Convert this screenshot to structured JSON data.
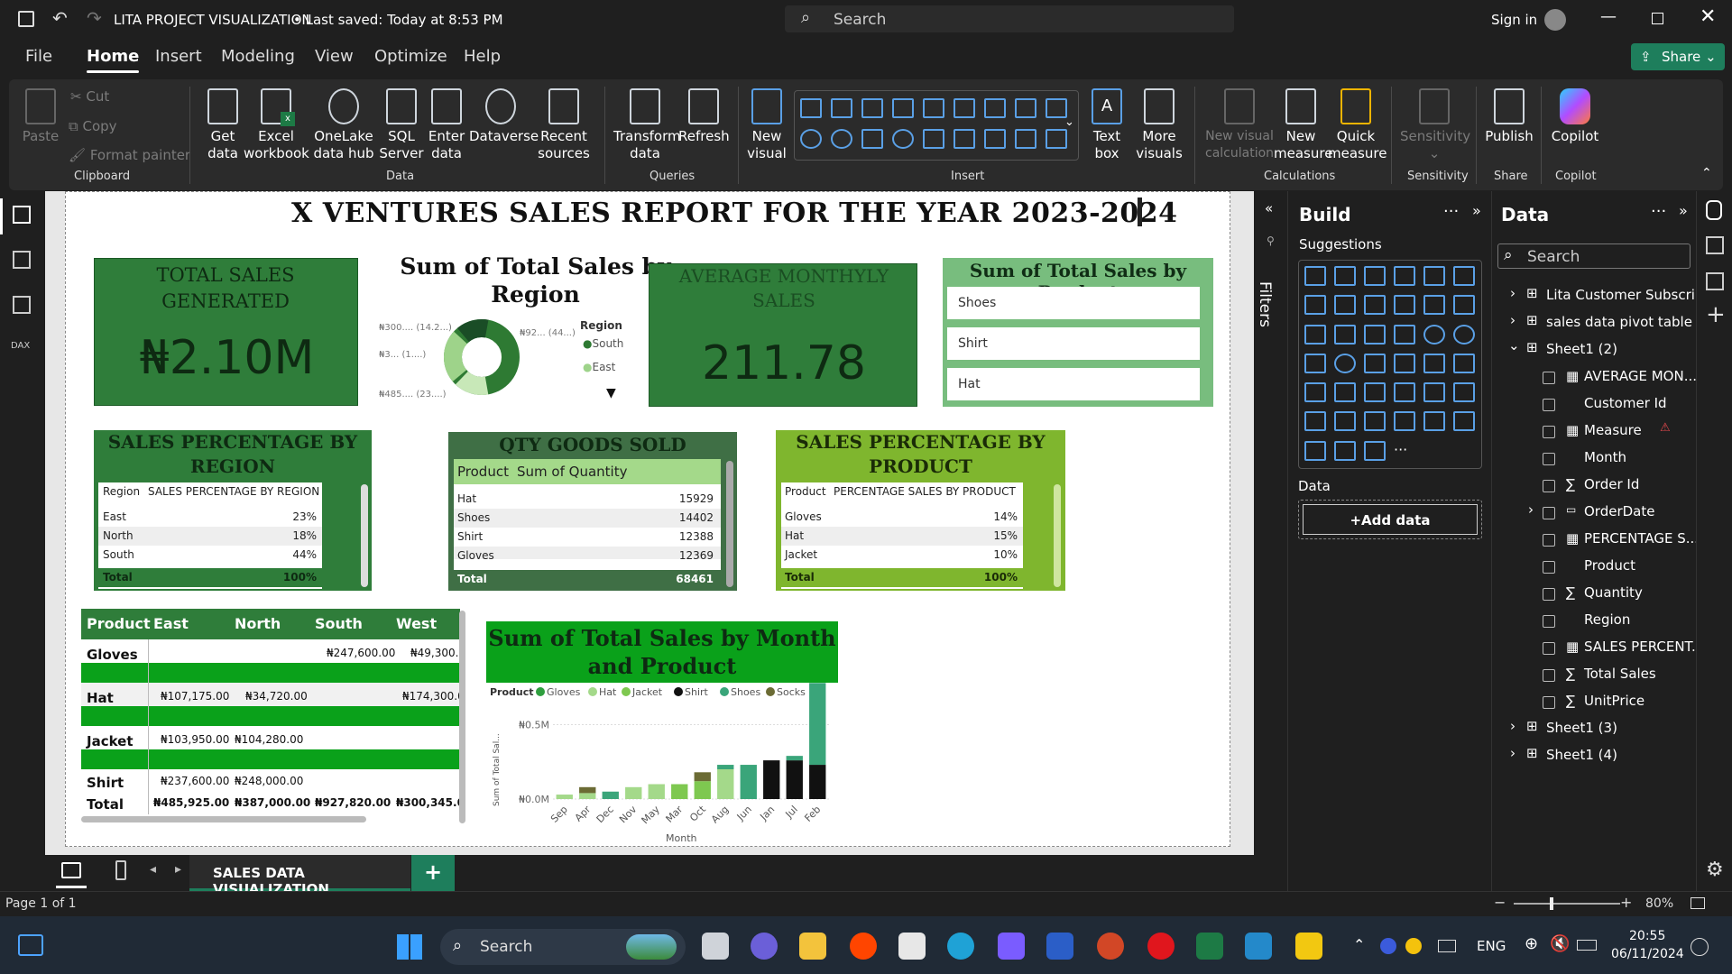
{
  "titlebar": {
    "title": "LITA PROJECT VISUALIZATION",
    "saved": "• Last saved: Today at 8:53 PM",
    "search_placeholder": "Search",
    "signin": "Sign in"
  },
  "menu": [
    "File",
    "Home",
    "Insert",
    "Modeling",
    "View",
    "Optimize",
    "Help"
  ],
  "share_label": "Share",
  "ribbon": {
    "clipboard": {
      "paste": "Paste",
      "cut": "Cut",
      "copy": "Copy",
      "format_painter": "Format painter",
      "group": "Clipboard"
    },
    "data": {
      "get_data": "Get\ndata",
      "excel": "Excel\nworkbook",
      "onelake": "OneLake\ndata hub",
      "sql": "SQL\nServer",
      "enter": "Enter\ndata",
      "dataverse": "Dataverse",
      "recent": "Recent\nsources",
      "group": "Data"
    },
    "queries": {
      "transform": "Transform\ndata",
      "refresh": "Refresh",
      "group": "Queries"
    },
    "insert": {
      "new_visual": "New\nvisual",
      "text_box": "Text\nbox",
      "more_visuals": "More\nvisuals",
      "group": "Insert"
    },
    "calculations": {
      "new_visual_calc": "New visual\ncalculation",
      "new_measure": "New\nmeasure",
      "quick_measure": "Quick\nmeasure",
      "group": "Calculations"
    },
    "sensitivity": {
      "label": "Sensitivity",
      "group": "Sensitivity"
    },
    "share": {
      "publish": "Publish",
      "group": "Share"
    },
    "copilot": {
      "label": "Copilot",
      "group": "Copilot"
    }
  },
  "report": {
    "title": "X VENTURES SALES REPORT FOR THE YEAR 2023-2024",
    "total_sales": {
      "label": "TOTAL SALES GENERATED",
      "value": "₦2.10M"
    },
    "region_donut": {
      "title": "Sum of Total Sales by Region",
      "legend_title": "Region",
      "legend": [
        "South",
        "East"
      ],
      "labels": [
        "₦300.... (14.2...)",
        "₦3... (1....)",
        "₦485.... (23....)",
        "₦92... (44...)"
      ]
    },
    "avg_monthly": {
      "label": "AVERAGE MONTHYLY SALES",
      "value": "211.78"
    },
    "product_slicer": {
      "title": "Sum of Total Sales by Product",
      "items": [
        "Shoes",
        "Shirt",
        "Hat"
      ]
    },
    "pct_region": {
      "title": "SALES PERCENTAGE BY REGION",
      "headers": [
        "Region",
        "SALES PERCENTAGE BY REGION"
      ],
      "rows": [
        [
          "East",
          "23%"
        ],
        [
          "North",
          "18%"
        ],
        [
          "South",
          "44%"
        ]
      ],
      "total": [
        "Total",
        "100%"
      ]
    },
    "qty_goods": {
      "title": "QTY GOODS SOLD",
      "headers": [
        "Product",
        "Sum of Quantity"
      ],
      "rows": [
        [
          "Hat",
          "15929"
        ],
        [
          "Shoes",
          "14402"
        ],
        [
          "Shirt",
          "12388"
        ],
        [
          "Gloves",
          "12369"
        ]
      ],
      "total": [
        "Total",
        "68461"
      ]
    },
    "pct_product": {
      "title": "SALES PERCENTAGE BY PRODUCT",
      "headers": [
        "Product",
        "PERCENTAGE SALES BY PRODUCT"
      ],
      "rows": [
        [
          "Gloves",
          "14%"
        ],
        [
          "Hat",
          "15%"
        ],
        [
          "Jacket",
          "10%"
        ]
      ],
      "total": [
        "Total",
        "100%"
      ]
    },
    "matrix": {
      "headers": [
        "Product",
        "East",
        "North",
        "South",
        "West"
      ],
      "rows": [
        [
          "Gloves",
          "",
          "",
          "₦247,600.00",
          "₦49,300.0"
        ],
        [
          "Hat",
          "₦107,175.00",
          "₦34,720.00",
          "",
          "₦174,300.0"
        ],
        [
          "Jacket",
          "₦103,950.00",
          "₦104,280.00",
          "",
          ""
        ],
        [
          "Shirt",
          "₦237,600.00",
          "₦248,000.00",
          "",
          ""
        ]
      ],
      "total": [
        "Total",
        "₦485,925.00",
        "₦387,000.00",
        "₦927,820.00",
        "₦300,345.0"
      ]
    },
    "month_chart_title": "Sum of Total Sales by Month and Product"
  },
  "chart_data": {
    "type": "bar",
    "title": "Sum of Total Sales by Month and Product",
    "xlabel": "Month",
    "ylabel": "Sum of Total Sal...",
    "legend_title": "Product",
    "yticks": [
      "₦0.5M",
      "₦0.0M"
    ],
    "ylim": [
      0,
      0.6
    ],
    "categories": [
      "Sep",
      "Apr",
      "Dec",
      "Nov",
      "May",
      "Mar",
      "Oct",
      "Aug",
      "Jun",
      "Jan",
      "Jul",
      "Feb"
    ],
    "series": [
      {
        "name": "Gloves",
        "color": "#2e9e3e",
        "values": [
          0,
          0,
          0,
          0,
          0,
          0,
          0,
          0,
          0,
          0,
          0,
          0
        ]
      },
      {
        "name": "Hat",
        "color": "#a4d98a",
        "values": [
          0.03,
          0.04,
          0,
          0.08,
          0.1,
          0,
          0,
          0.2,
          0,
          0,
          0,
          0
        ]
      },
      {
        "name": "Jacket",
        "color": "#7ec850",
        "values": [
          0,
          0,
          0,
          0,
          0,
          0.1,
          0.12,
          0,
          0,
          0,
          0,
          0
        ]
      },
      {
        "name": "Shirt",
        "color": "#111111",
        "values": [
          0,
          0,
          0,
          0,
          0,
          0,
          0,
          0,
          0,
          0.26,
          0.26,
          0.23
        ]
      },
      {
        "name": "Shoes",
        "color": "#3aa57a",
        "values": [
          0,
          0,
          0.05,
          0,
          0,
          0,
          0,
          0.03,
          0.23,
          0,
          0.03,
          0.55
        ]
      },
      {
        "name": "Socks",
        "color": "#6b6b34",
        "values": [
          0,
          0.04,
          0,
          0,
          0,
          0,
          0.06,
          0,
          0,
          0,
          0,
          0
        ]
      }
    ]
  },
  "filters_label": "Filters",
  "build": {
    "title": "Build",
    "suggestions": "Suggestions",
    "data_label": "Data",
    "add_data": "+Add data"
  },
  "data_pane": {
    "title": "Data",
    "search_placeholder": "Search",
    "tables": [
      "Lita Customer Subscri...",
      "sales data pivot table",
      "Sheet1 (2)"
    ],
    "fields": [
      "AVERAGE MON...",
      "Customer Id",
      "Measure",
      "Month",
      "Order Id",
      "OrderDate",
      "PERCENTAGE S...",
      "Product",
      "Quantity",
      "Region",
      "SALES PERCENT...",
      "Total Sales",
      "UnitPrice"
    ],
    "more_tables": [
      "Sheet1 (3)",
      "Sheet1 (4)"
    ]
  },
  "tab": {
    "label": "SALES DATA VISUALIZATION",
    "add": "+"
  },
  "status": {
    "page": "Page 1 of 1",
    "zoom": "80%"
  },
  "taskbar": {
    "search": "Search",
    "lang": "ENG",
    "time": "20:55",
    "date": "06/11/2024"
  },
  "colors": {
    "green_dark": "#2f7d3a",
    "green_mid": "#3f6f45",
    "green_lime": "#7fb62e",
    "green_bright": "#0aa11a"
  }
}
